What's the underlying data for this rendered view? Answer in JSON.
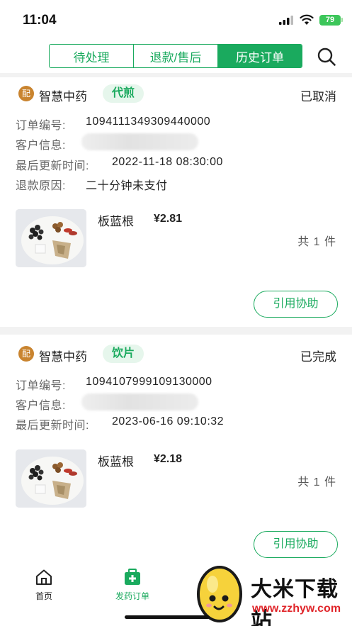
{
  "status_bar": {
    "time": "11:04",
    "battery": "79"
  },
  "tabs": [
    {
      "label": "待处理",
      "active": false
    },
    {
      "label": "退款/售后",
      "active": false
    },
    {
      "label": "历史订单",
      "active": true
    }
  ],
  "orders": [
    {
      "badge": "配",
      "shop": "智慧中药",
      "type_tag": "代煎",
      "status": "已取消",
      "order_no_label": "订单编号:",
      "order_no": "1094111349309440000",
      "customer_label": "客户信息:",
      "updated_label": "最后更新时间:",
      "updated": "2022-11-18 08:30:00",
      "refund_label": "退款原因:",
      "refund_reason": "二十分钟未支付",
      "item_name": "板蓝根",
      "price": "¥2.81",
      "qty": "共 1 件",
      "button": "引用协助"
    },
    {
      "badge": "配",
      "shop": "智慧中药",
      "type_tag": "饮片",
      "status": "已完成",
      "order_no_label": "订单编号:",
      "order_no": "1094107999109130000",
      "customer_label": "客户信息:",
      "updated_label": "最后更新时间:",
      "updated": "2023-06-16 09:10:32",
      "item_name": "板蓝根",
      "price": "¥2.18",
      "qty": "共 1 件",
      "button": "引用协助"
    }
  ],
  "bottom_nav": [
    {
      "label": "首页",
      "icon": "home-icon",
      "active": false
    },
    {
      "label": "发药订单",
      "icon": "medicine-box-icon",
      "active": true
    }
  ],
  "watermark": {
    "title": "大米下载站",
    "url": "www.zzhyw.com"
  },
  "colors": {
    "accent": "#1aaa5e",
    "badge": "#c9842f",
    "tag_bg": "#e6f6ec",
    "watermark_url": "#e0252a"
  }
}
